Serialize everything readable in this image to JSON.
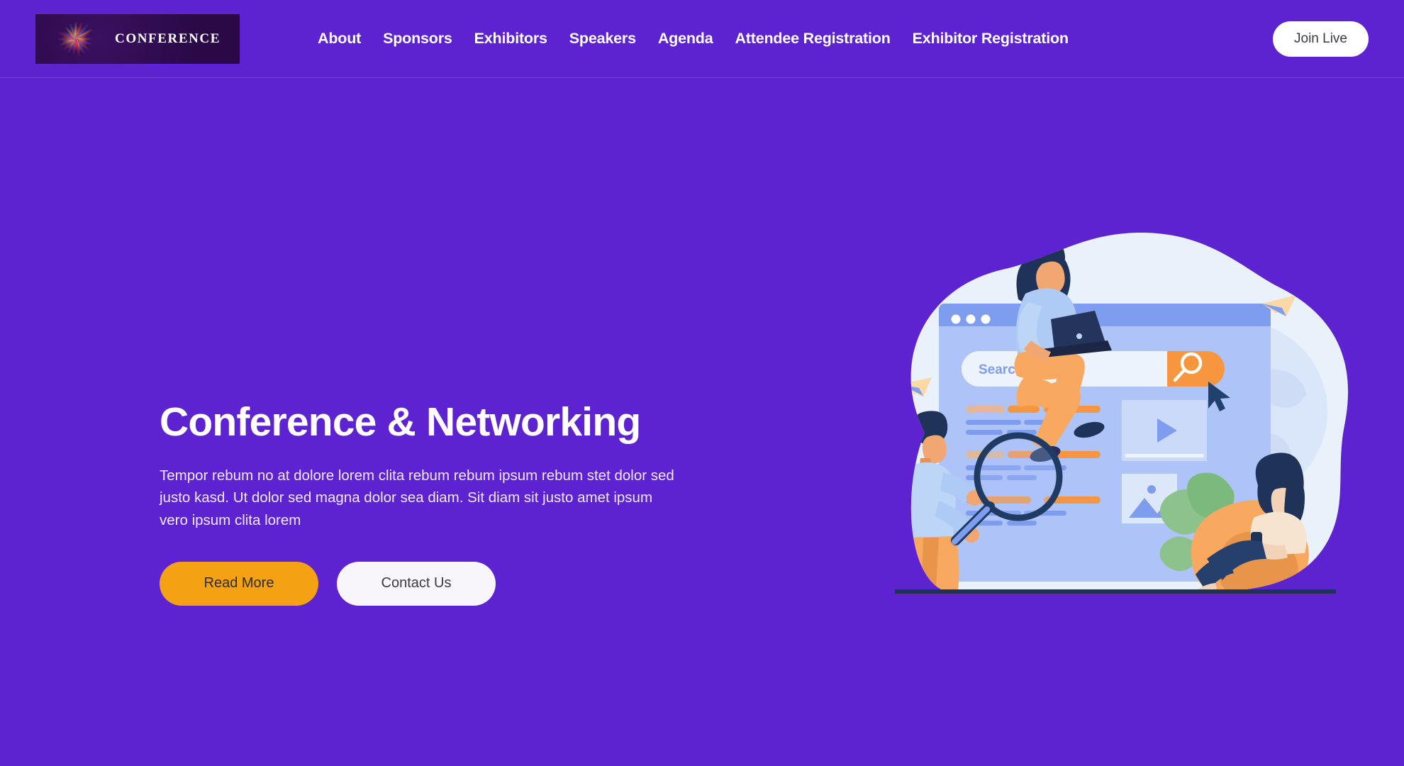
{
  "header": {
    "logo": {
      "name": "CONFERENCE",
      "icon": "firework-burst-icon",
      "bg_color": "#2B0A48"
    },
    "nav_items": [
      {
        "label": "About"
      },
      {
        "label": "Sponsors"
      },
      {
        "label": "Exhibitors"
      },
      {
        "label": "Speakers"
      },
      {
        "label": "Agenda"
      },
      {
        "label": "Attendee Registration"
      },
      {
        "label": "Exhibitor Registration"
      }
    ],
    "join_live_label": "Join Live"
  },
  "hero": {
    "title": "Conference & Networking",
    "paragraph": "Tempor rebum no at dolore lorem clita rebum rebum ipsum rebum stet dolor sed justo kasd. Ut dolor sed magna dolor sea diam. Sit diam sit justo amet ipsum vero ipsum clita lorem",
    "primary_button": "Read More",
    "secondary_button": "Contact Us"
  },
  "illustration": {
    "alt": "people searching on a giant browser window",
    "search_placeholder": "Search....",
    "search_icon": "magnifier-icon",
    "cursor_icon": "mouse-pointer-icon",
    "video_card_icon": "play-triangle-icon",
    "image_card_icon": "mountain-photo-icon"
  },
  "colors": {
    "background_purple": "#5E23D0",
    "accent_orange": "#F5A114",
    "illustration_orange": "#F79A4B",
    "illustration_blue": "#A7BEF5",
    "illustration_navy": "#1F3A63",
    "blob_light": "#E8F0FB",
    "white": "#FFFFFF"
  }
}
